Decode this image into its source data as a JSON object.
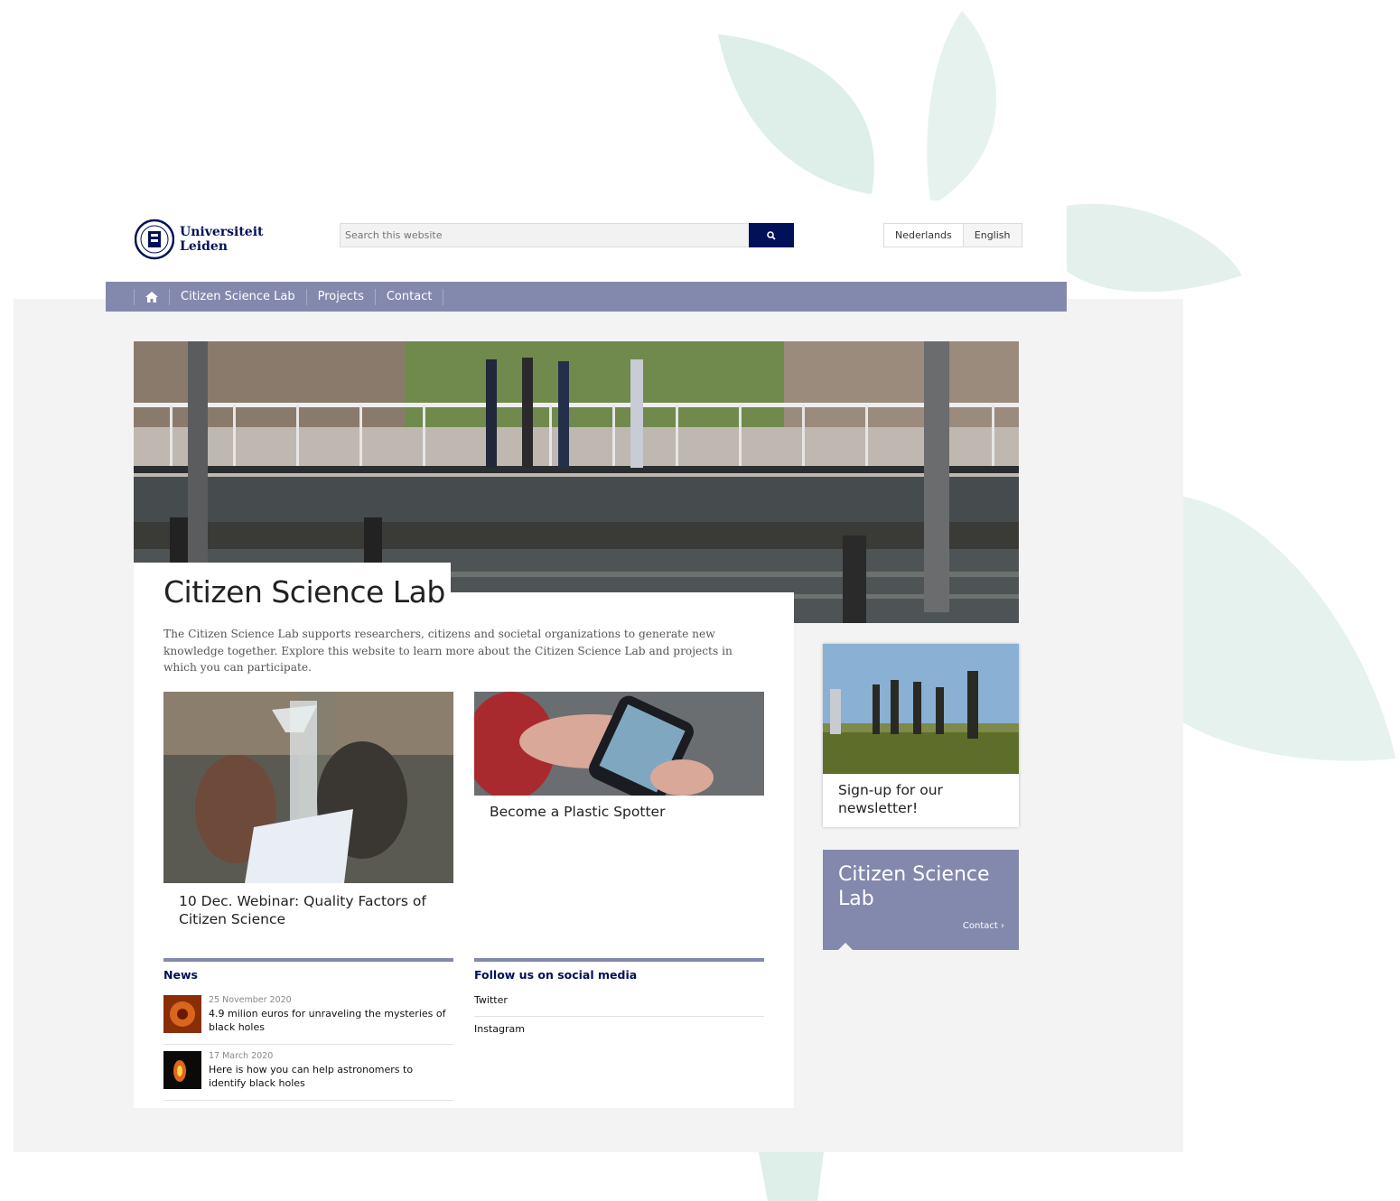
{
  "header": {
    "logo_line1": "Universiteit",
    "logo_line2": "Leiden",
    "search_placeholder": "Search this website",
    "languages": [
      "Nederlands",
      "English"
    ]
  },
  "nav": {
    "home_icon": "home-icon",
    "items": [
      "Citizen Science Lab",
      "Projects",
      "Contact"
    ]
  },
  "main": {
    "title": "Citizen Science Lab",
    "intro": "The Citizen Science Lab supports researchers, citizens and societal organizations to generate new knowledge together. Explore this website to learn more about the Citizen Science Lab and projects in which you can participate.",
    "cards": [
      {
        "title": "10 Dec. Webinar: Quality Factors of Citizen Science"
      },
      {
        "title": "Become a Plastic Spotter"
      }
    ]
  },
  "news": {
    "heading": "News",
    "items": [
      {
        "date": "25 November 2020",
        "title": "4.9 milion euros for unraveling the mysteries of black holes"
      },
      {
        "date": "17 March 2020",
        "title": "Here is how you can help astronomers to identify black holes"
      }
    ]
  },
  "social": {
    "heading": "Follow us on social media",
    "links": [
      "Twitter",
      "Instagram"
    ]
  },
  "sidebar": {
    "newsletter_title": "Sign-up for our newsletter!",
    "promo_title": "Citizen Science Lab",
    "promo_link": "Contact ›"
  },
  "colors": {
    "brand_navy": "#001158",
    "nav_bar": "#8389ad",
    "leaf_tint": "#e3f0ec"
  }
}
